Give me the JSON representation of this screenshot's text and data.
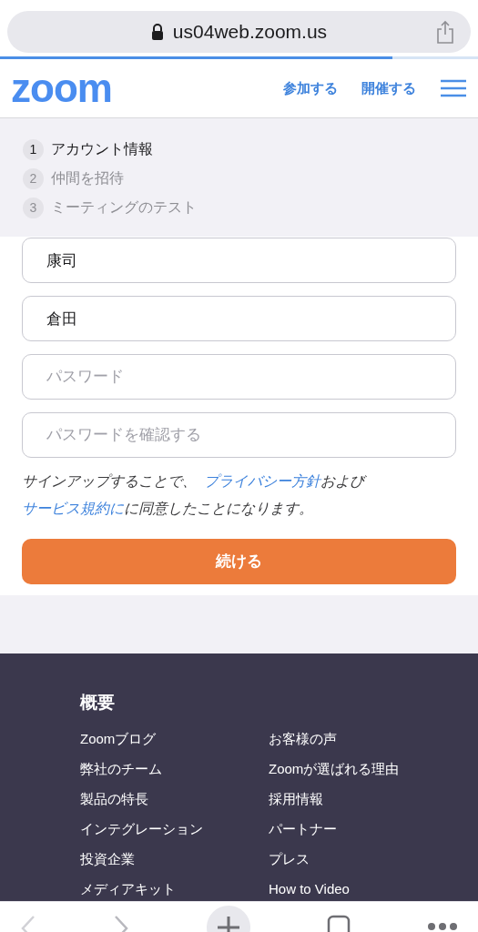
{
  "browser": {
    "url": "us04web.zoom.us",
    "progress": {
      "level": 0.82
    }
  },
  "header": {
    "logo": "zoom",
    "links": [
      "参加する",
      "開催する"
    ]
  },
  "steps": [
    {
      "number": "1",
      "label": "アカウント情報",
      "selected": true
    },
    {
      "number": "2",
      "label": "仲間を招待",
      "selected": false
    },
    {
      "number": "3",
      "label": "ミーティングのテスト",
      "selected": false
    }
  ],
  "fields": [
    {
      "value": "康司"
    },
    {
      "value": "倉田"
    },
    {
      "placeholder": "パスワード"
    },
    {
      "placeholder": "パスワードを確認する"
    }
  ],
  "agreement": {
    "before": "サインアップすることで、",
    "link_1": "プライバシー方針",
    "middle": "および",
    "link_2": "サービス規約に",
    "after": "に同意したことになります。"
  },
  "continue_button": "続ける",
  "footer": {
    "title": "概要",
    "columns": [
      [
        "Zoomブログ",
        "弊社のチーム",
        "製品の特長",
        "インテグレーション",
        "投資企業",
        "メディアキット"
      ],
      [
        "お客様の声",
        "Zoomが選ばれる理由",
        "採用情報",
        "パートナー",
        "プレス",
        "How to Video"
      ]
    ]
  },
  "toolbar": {
    "back_disabled": true,
    "forward_disabled": false
  }
}
